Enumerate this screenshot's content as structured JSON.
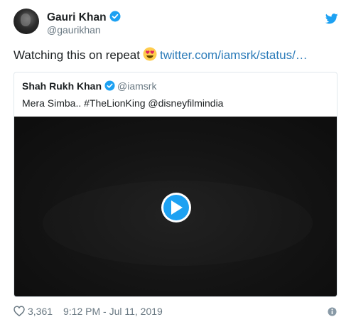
{
  "author": {
    "display_name": "Gauri Khan",
    "handle": "@gaurikhan",
    "verified": true
  },
  "tweet": {
    "text_before_emoji": "Watching this on repeat",
    "emoji": "smiling-face-with-heart-eyes",
    "link_text": "twitter.com/iamsrk/status/…"
  },
  "quoted_tweet": {
    "display_name": "Shah Rukh Khan",
    "handle": "@iamsrk",
    "verified": true,
    "text": "Mera Simba.. #TheLionKing @disneyfilmindia",
    "media": {
      "type": "video",
      "play_icon": "play-icon"
    }
  },
  "footer": {
    "like_count": "3,361",
    "timestamp": "9:12 PM - Jul 11, 2019",
    "like_icon": "heart-icon",
    "info_icon": "info-icon"
  },
  "colors": {
    "brand_blue": "#1da1f2",
    "link_blue": "#2b7bb9",
    "text_primary": "#1c2022",
    "text_secondary": "#697882",
    "border": "#e1e8ed",
    "video_bg": "#141414"
  }
}
